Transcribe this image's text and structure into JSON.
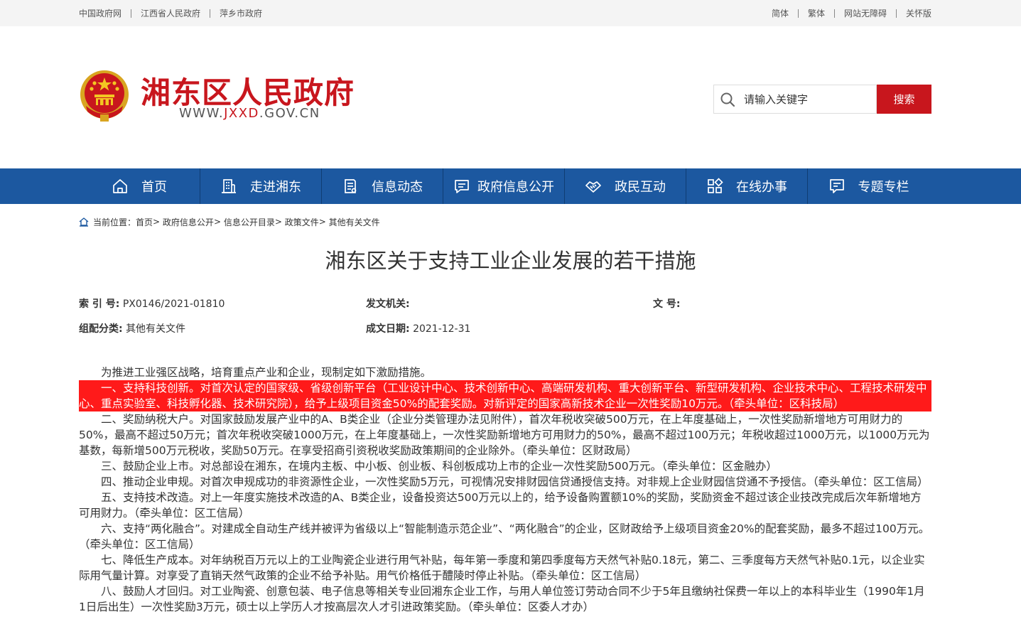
{
  "topbar": {
    "left_links": [
      "中国政府网",
      "江西省人民政府",
      "萍乡市政府"
    ],
    "right_links": [
      "简体",
      "繁体",
      "网站无障碍",
      "关怀版"
    ]
  },
  "header": {
    "site_title": "湘东区人民政府",
    "url_prefix": "WWW.",
    "url_highlight": "JXXD",
    "url_suffix": ".GOV.CN",
    "search_placeholder": "请输入关键字",
    "search_button": "搜索"
  },
  "nav": [
    {
      "label": "首页",
      "icon": "home-icon"
    },
    {
      "label": "走进湘东",
      "icon": "building-icon"
    },
    {
      "label": "信息动态",
      "icon": "document-icon"
    },
    {
      "label": "政府信息公开",
      "icon": "chat-icon"
    },
    {
      "label": "政民互动",
      "icon": "handshake-icon"
    },
    {
      "label": "在线办事",
      "icon": "grid-icon"
    },
    {
      "label": "专题专栏",
      "icon": "list-icon"
    }
  ],
  "breadcrumb": {
    "prefix": "当前位置：",
    "items": [
      "首页",
      "政府信息公开",
      "信息公开目录",
      "政策文件",
      "其他有关文件"
    ],
    "separator": ">"
  },
  "article": {
    "title": "湘东区关于支持工业企业发展的若干措施",
    "meta": {
      "index_label": "索 引 号:",
      "index_value": "PX0146/2021-01810",
      "issuer_label": "发文机关:",
      "issuer_value": "",
      "docno_label": "文 号:",
      "docno_value": "",
      "category_label": "组配分类:",
      "category_value": "其他有关文件",
      "date_label": "成文日期:",
      "date_value": "2021-12-31"
    },
    "paragraphs": [
      "为推进工业强区战略，培育重点产业和企业，现制定如下激励措施。",
      "一、支持科技创新。对首次认定的国家级、省级创新平台（工业设计中心、技术创新中心、高端研发机构、重大创新平台、新型研发机构、企业技术中心、工程技术研发中心、重点实验室、科技孵化器、技术研究院），给予上级项目资金50%的配套奖励。对新评定的国家高新技术企业一次性奖励10万元。（牵头单位：区科技局）",
      "二、奖励纳税大户。对国家鼓励发展产业中的A、B类企业（企业分类管理办法见附件），首次年税收突破500万元，在上年度基础上，一次性奖励新增地方可用财力的50%，最高不超过50万元；首次年税收突破1000万元，在上年度基础上，一次性奖励新增地方可用财力的50%，最高不超过100万元；年税收超过1000万元，以1000万元为基数，每新增500万元税收，奖励50万元。在享受招商引资税收奖励政策期间的企业除外。（牵头单位：区财政局）",
      "三、鼓励企业上市。对总部设在湘东，在境内主板、中小板、创业板、科创板成功上市的企业一次性奖励500万元。（牵头单位：区金融办）",
      "四、推动企业申规。对首次申规成功的非资源性企业，一次性奖励5万元，可视情况安排财园信贷通授信支持。对非规上企业财园信贷通不予授信。（牵头单位：区工信局）",
      "五、支持技术改造。对上一年度实施技术改造的A、B类企业，设备投资达500万元以上的，给予设备购置额10%的奖励，奖励资金不超过该企业技改完成后次年新增地方可用财力。（牵头单位：区工信局）",
      "六、支持“两化融合”。对建成全自动生产线并被评为省级以上“智能制造示范企业”、“两化融合”的企业，区财政给予上级项目资金20%的配套奖励，最多不超过100万元。（牵头单位：区工信局）",
      "七、降低生产成本。对年纳税百万元以上的工业陶瓷企业进行用气补贴，每年第一季度和第四季度每方天然气补贴0.18元，第二、三季度每方天然气补贴0.1元，以企业实际用气量计算。对享受了直销天然气政策的企业不给予补贴。用气价格低于醴陵时停止补贴。（牵头单位：区工信局）",
      "八、鼓励人才回归。对工业陶瓷、创意包装、电子信息等相关专业回湘东企业工作，与用人单位签订劳动合同不少于5年且缴纳社保费一年以上的本科毕业生（1990年1月1日后出生）一次性奖励3万元，硕士以上学历人才按高层次人才引进政策奖励。（牵头单位：区委人才办）"
    ],
    "highlighted_paragraph": 1
  },
  "colors": {
    "brand_red": "#c8161d",
    "nav_blue": "#1c58a0",
    "highlight_red": "#ff1a1a"
  }
}
